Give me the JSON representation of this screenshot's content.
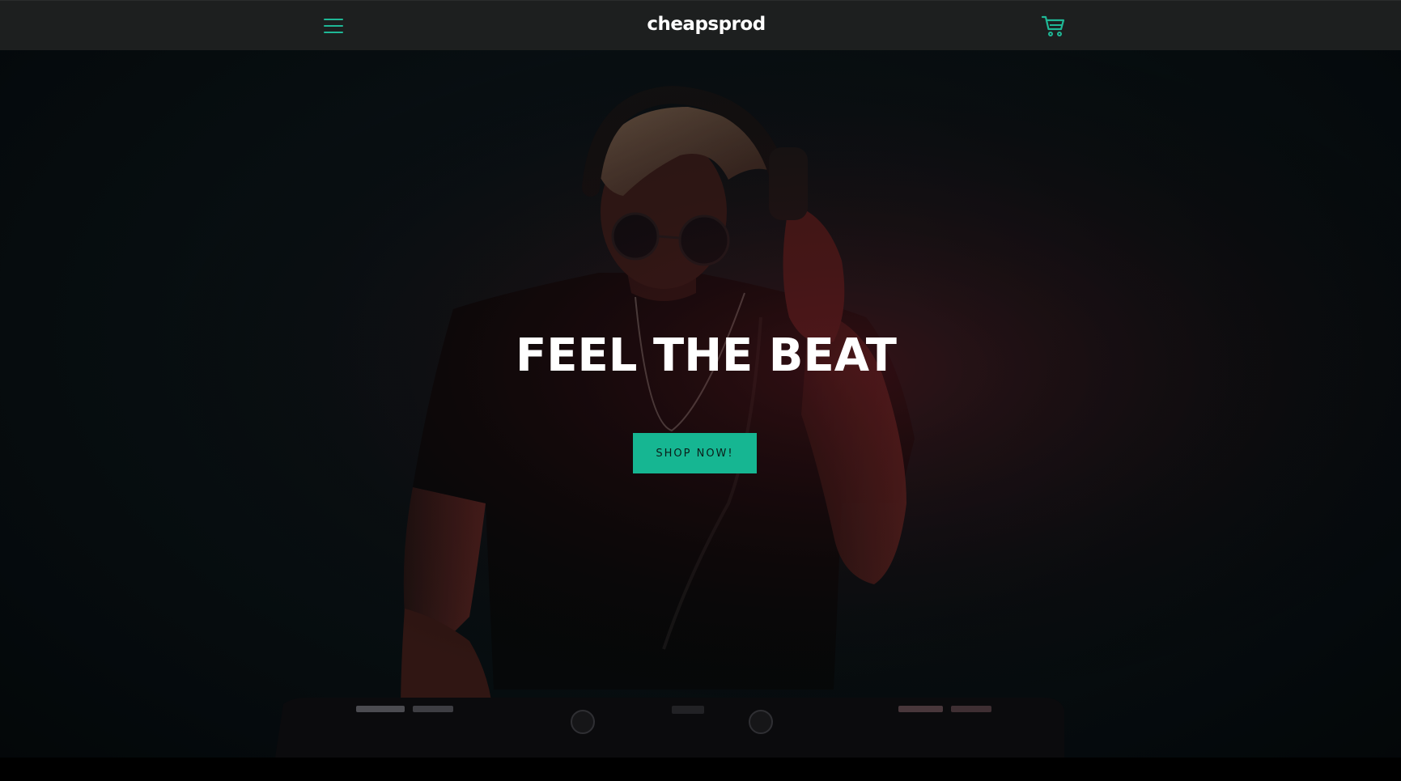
{
  "header": {
    "logo_text": "cheapsprod",
    "menu_icon": "hamburger-menu-icon",
    "cart_icon": "shopping-cart-icon"
  },
  "hero": {
    "title": "FEEL THE BEAT",
    "cta_label": "SHOP NOW!",
    "image_alt": "DJ with headphones and sunglasses at a mixer"
  },
  "colors": {
    "accent": "#16b692",
    "header_bg": "#1d1f1f",
    "hero_bg": "#0a1316",
    "text": "#ffffff"
  }
}
